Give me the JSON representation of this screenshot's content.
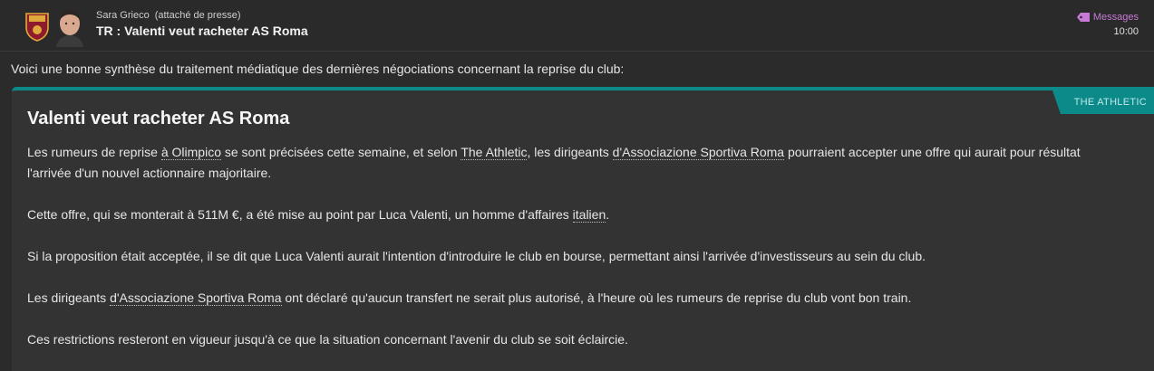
{
  "header": {
    "sender_name": "Sara Grieco",
    "sender_role": "(attaché de presse)",
    "subject": "TR : Valenti veut racheter AS Roma",
    "messages_link": "Messages",
    "time": "10:00"
  },
  "intro": "Voici une bonne synthèse du traitement médiatique des dernières négociations concernant la reprise du club:",
  "article": {
    "source": "THE ATHLETIC",
    "title": "Valenti veut racheter AS Roma",
    "p1": {
      "a": "Les rumeurs de reprise ",
      "link1": "à Olimpico",
      "b": " se sont précisées cette semaine, et selon ",
      "link2": "The Athletic",
      "c": ", les dirigeants ",
      "link3": "d'Associazione Sportiva Roma",
      "d": " pourraient accepter une offre qui aurait pour résultat l'arrivée d'un nouvel actionnaire majoritaire."
    },
    "p2": {
      "a": "Cette offre, qui se monterait à 511M €, a été mise au point par Luca Valenti, un homme d'affaires ",
      "link1": "italien",
      "b": "."
    },
    "p3": "Si la proposition était acceptée, il se dit que Luca Valenti aurait l'intention d'introduire le club en bourse, permettant ainsi l'arrivée d'investisseurs au sein du club.",
    "p4": {
      "a": "Les dirigeants ",
      "link1": "d'Associazione Sportiva Roma",
      "b": " ont déclaré qu'aucun transfert ne serait plus autorisé, à l'heure où les rumeurs de reprise du club vont bon train."
    },
    "p5": "Ces restrictions resteront en vigueur jusqu'à ce que la situation concernant l'avenir du club se soit éclaircie."
  },
  "colors": {
    "accent_teal": "#0c8a8a",
    "link_purple": "#c77ad6",
    "background": "#2b2b2b"
  }
}
